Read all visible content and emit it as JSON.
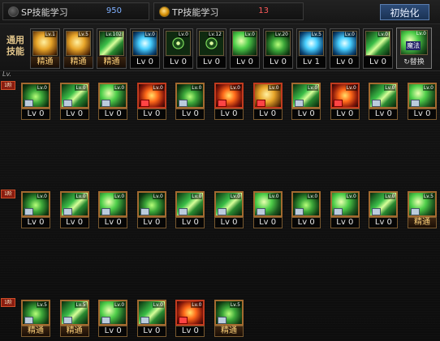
{
  "tabs": {
    "sp": {
      "label": "SP技能学习",
      "value": "950"
    },
    "tp": {
      "label": "TP技能学习",
      "value": "13"
    }
  },
  "reset_button": "初始化",
  "common": {
    "label": "通用技能",
    "skills": [
      {
        "icon": "seated-meditation-icon",
        "tag": "Lv.1",
        "level": "精通",
        "master": true
      },
      {
        "icon": "golden-phoenix-icon",
        "tag": "Lv.5",
        "level": "精通",
        "master": true
      },
      {
        "icon": "green-slash-icon",
        "tag": "Lv.102",
        "level": "精通",
        "master": true
      },
      {
        "icon": "cyan-wings-icon",
        "tag": "Lv.0",
        "level": "Lv 0",
        "master": false
      },
      {
        "icon": "target-crosshair-icon",
        "tag": "Lv.0",
        "level": "Lv 0",
        "master": false
      },
      {
        "icon": "target-sparkle-icon",
        "tag": "Lv.12",
        "level": "Lv 0",
        "master": false
      },
      {
        "icon": "running-figure-icon",
        "tag": "Lv.0",
        "level": "Lv 0",
        "master": false
      },
      {
        "icon": "leaping-figure-icon",
        "tag": "Lv.20",
        "level": "Lv 0",
        "master": false
      },
      {
        "icon": "cyan-eye-icon",
        "tag": "Lv.5",
        "level": "Lv 1",
        "master": false
      },
      {
        "icon": "armored-figure-icon",
        "tag": "Lv.0",
        "level": "Lv 0",
        "master": false
      },
      {
        "icon": "green-blade-icon",
        "tag": "Lv.0",
        "level": "Lv 0",
        "master": false
      }
    ],
    "switch": {
      "icon": "magic-book-icon",
      "tag": "Lv.0",
      "badge": "魔法",
      "label": "↻替换"
    }
  },
  "lv_marker": "Lv.",
  "rows": [
    {
      "tag": "1阶",
      "skills": [
        {
          "icon": "green-claw-icon",
          "tag": "Lv.0",
          "level": "Lv 0",
          "red": false,
          "master": false,
          "art": "g1"
        },
        {
          "icon": "green-sword-icon",
          "tag": "Lv.0",
          "level": "Lv 0",
          "red": false,
          "master": false,
          "art": "g2"
        },
        {
          "icon": "green-dash-icon",
          "tag": "Lv.0",
          "level": "Lv 0",
          "red": false,
          "master": false,
          "art": "g3"
        },
        {
          "icon": "red-burst-icon",
          "tag": "Lv.0",
          "level": "Lv 0",
          "red": true,
          "master": false,
          "art": "r1"
        },
        {
          "icon": "green-orb-icon",
          "tag": "Lv.0",
          "level": "Lv 0",
          "red": false,
          "master": false,
          "art": "g1"
        },
        {
          "icon": "red-arrow-icon",
          "tag": "Lv.0",
          "level": "Lv 0",
          "red": true,
          "master": false,
          "art": "r1"
        },
        {
          "icon": "gold-spark-icon",
          "tag": "Lv.0",
          "level": "Lv 0",
          "red": true,
          "master": false,
          "art": "gold"
        },
        {
          "icon": "green-slash-icon",
          "tag": "Lv.0",
          "level": "Lv 0",
          "red": false,
          "master": false,
          "art": "g2"
        },
        {
          "icon": "red-spear-icon",
          "tag": "Lv.0",
          "level": "Lv 0",
          "red": true,
          "master": false,
          "art": "r1"
        },
        {
          "icon": "green-stab-icon",
          "tag": "Lv.0",
          "level": "Lv 0",
          "red": false,
          "master": false,
          "art": "g2"
        },
        {
          "icon": "green-kick-icon",
          "tag": "Lv.0",
          "level": "Lv 0",
          "red": false,
          "master": false,
          "art": "g3"
        }
      ]
    },
    {
      "tag": "1阶",
      "skills": [
        {
          "icon": "green-fist-icon",
          "tag": "Lv.0",
          "level": "Lv 0",
          "red": false,
          "master": false,
          "art": "g1"
        },
        {
          "icon": "green-blade-icon",
          "tag": "Lv.0",
          "level": "Lv 0",
          "red": false,
          "master": false,
          "art": "g2"
        },
        {
          "icon": "green-swirl-icon",
          "tag": "Lv.0",
          "level": "Lv 0",
          "red": false,
          "master": false,
          "art": "g3"
        },
        {
          "icon": "green-kick-icon",
          "tag": "Lv.0",
          "level": "Lv 0",
          "red": false,
          "master": false,
          "art": "g1"
        },
        {
          "icon": "green-slash-icon",
          "tag": "Lv.0",
          "level": "Lv 0",
          "red": false,
          "master": false,
          "art": "g2"
        },
        {
          "icon": "green-cut-icon",
          "tag": "Lv.0",
          "level": "Lv 0",
          "red": false,
          "master": false,
          "art": "g2"
        },
        {
          "icon": "green-ring-icon",
          "tag": "Lv.0",
          "level": "Lv 0",
          "red": false,
          "master": false,
          "art": "g3"
        },
        {
          "icon": "green-crest-icon",
          "tag": "Lv.0",
          "level": "Lv 0",
          "red": false,
          "master": false,
          "art": "g1"
        },
        {
          "icon": "green-wave-icon",
          "tag": "Lv.0",
          "level": "Lv 0",
          "red": false,
          "master": false,
          "art": "g3"
        },
        {
          "icon": "green-cross-icon",
          "tag": "Lv.0",
          "level": "Lv 0",
          "red": false,
          "master": false,
          "art": "g2"
        },
        {
          "icon": "green-rush-icon",
          "tag": "Lv.5",
          "level": "精通",
          "red": false,
          "master": true,
          "art": "g3"
        }
      ]
    },
    {
      "tag": "1阶",
      "skills": [
        {
          "icon": "green-spin-icon",
          "tag": "Lv.5",
          "level": "精通",
          "red": false,
          "master": true,
          "art": "g1"
        },
        {
          "icon": "green-strike-icon",
          "tag": "Lv.5",
          "level": "精通",
          "red": false,
          "master": true,
          "art": "g2"
        },
        {
          "icon": "green-shield-icon",
          "tag": "Lv.0",
          "level": "Lv 0",
          "red": false,
          "master": false,
          "art": "g3"
        },
        {
          "icon": "green-stripes-icon",
          "tag": "Lv.0",
          "level": "Lv 0",
          "red": false,
          "master": false,
          "art": "g2"
        },
        {
          "icon": "red-dome-icon",
          "tag": "Lv.0",
          "level": "Lv 0",
          "red": true,
          "master": false,
          "art": "r1"
        },
        {
          "icon": "green-aura-icon",
          "tag": "Lv.5",
          "level": "精通",
          "red": false,
          "master": true,
          "art": "g1"
        }
      ]
    }
  ]
}
